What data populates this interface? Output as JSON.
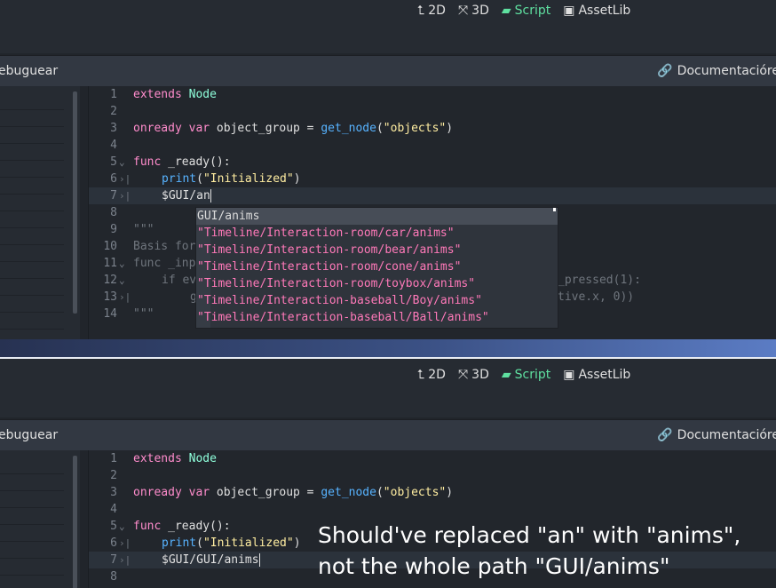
{
  "modes": [
    {
      "label": "2D",
      "icon": "2d-icon"
    },
    {
      "label": "3D",
      "icon": "3d-icon"
    },
    {
      "label": "Script",
      "icon": "script-icon",
      "active": true
    },
    {
      "label": "AssetLib",
      "icon": "assetlib-icon"
    }
  ],
  "menubar": {
    "left_text": "ebuguear",
    "docs_label": "Documentacióre"
  },
  "top_editor": {
    "lines": [
      {
        "n": "1",
        "fold": "",
        "tab": false
      },
      {
        "n": "2",
        "fold": "",
        "tab": false
      },
      {
        "n": "3",
        "fold": "",
        "tab": false
      },
      {
        "n": "4",
        "fold": "",
        "tab": false
      },
      {
        "n": "5",
        "fold": "⌄",
        "tab": false
      },
      {
        "n": "6",
        "fold": "",
        "tab": true
      },
      {
        "n": "7",
        "fold": "",
        "tab": true
      },
      {
        "n": "8",
        "fold": "",
        "tab": false
      },
      {
        "n": "9",
        "fold": "",
        "tab": false
      },
      {
        "n": "10",
        "fold": "",
        "tab": false
      },
      {
        "n": "11",
        "fold": "⌄",
        "tab": false
      },
      {
        "n": "12",
        "fold": "⌄",
        "tab": false
      },
      {
        "n": "13",
        "fold": "",
        "tab": true
      },
      {
        "n": "14",
        "fold": "",
        "tab": false
      }
    ],
    "text": {
      "l1a": "extends",
      "l1b": "Node",
      "l3a": "onready",
      "l3b": "var",
      "l3c": " object_group = ",
      "l3d": "get_node",
      "l3e": "(",
      "l3f": "\"objects\"",
      "l3g": ")",
      "l5a": "func",
      "l5b": " _ready():",
      "l6a": "print",
      "l6b": "(",
      "l6c": "\"Initialized\"",
      "l6d": ")",
      "l7": "$GUI/an",
      "l9": "\"\"\"",
      "l10": "Basis for",
      "l11": "func _inp",
      "l12a": "if ev",
      "l12b": "_pressed(1):",
      "l13a": "g",
      "l13b": "tive.x, 0))",
      "l14": "\"\"\""
    }
  },
  "autocomplete": [
    "GUI/anims",
    "\"Timeline/Interaction-room/car/anims\"",
    "\"Timeline/Interaction-room/bear/anims\"",
    "\"Timeline/Interaction-room/cone/anims\"",
    "\"Timeline/Interaction-room/toybox/anims\"",
    "\"Timeline/Interaction-baseball/Boy/anims\"",
    "\"Timeline/Interaction-baseball/Ball/anims\""
  ],
  "bottom_editor": {
    "lines": [
      {
        "n": "1",
        "fold": "",
        "tab": false
      },
      {
        "n": "2",
        "fold": "",
        "tab": false
      },
      {
        "n": "3",
        "fold": "",
        "tab": false
      },
      {
        "n": "4",
        "fold": "",
        "tab": false
      },
      {
        "n": "5",
        "fold": "⌄",
        "tab": false
      },
      {
        "n": "6",
        "fold": "",
        "tab": true
      },
      {
        "n": "7",
        "fold": "",
        "tab": true
      },
      {
        "n": "8",
        "fold": "",
        "tab": false
      }
    ],
    "text": {
      "l7": "$GUI/GUI/anims"
    }
  },
  "caption": "Should've replaced \"an\" with \"anims\",\nnot the whole path \"GUI/anims\"",
  "colors": {
    "accent": "#5fe0a0",
    "string": "#ffeda1",
    "function": "#57b3ff",
    "autocomplete_text": "#ff79b9"
  }
}
